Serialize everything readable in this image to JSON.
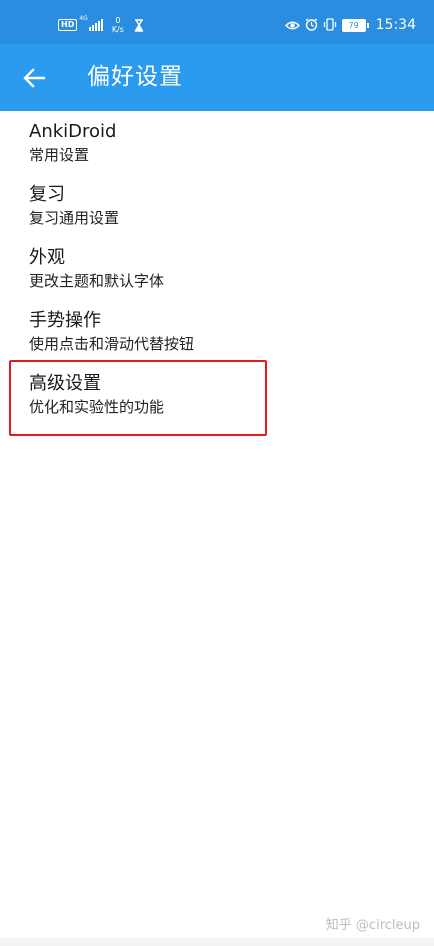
{
  "status_bar": {
    "hd_label": "HD",
    "network_label": "4G",
    "speed_value": "0",
    "speed_unit": "K/s",
    "battery_level": "79",
    "time": "15:34",
    "icons": [
      "hourglass-icon",
      "eye-icon",
      "alarm-icon",
      "vibrate-icon",
      "battery-icon"
    ]
  },
  "app_bar": {
    "title": "偏好设置",
    "back_icon": "arrow-left-icon"
  },
  "preferences": [
    {
      "title": "AnkiDroid",
      "summary": "常用设置"
    },
    {
      "title": "复习",
      "summary": "复习通用设置"
    },
    {
      "title": "外观",
      "summary": "更改主题和默认字体"
    },
    {
      "title": "手势操作",
      "summary": "使用点击和滑动代替按钮"
    },
    {
      "title": "高级设置",
      "summary": "优化和实验性的功能"
    }
  ],
  "highlight": {
    "target": "高级设置",
    "color": "#e21c1c"
  },
  "watermark": "知乎 @circleup",
  "colors": {
    "status_bar": "#2b8de0",
    "app_bar": "#2b9bf0",
    "background": "#ffffff"
  }
}
